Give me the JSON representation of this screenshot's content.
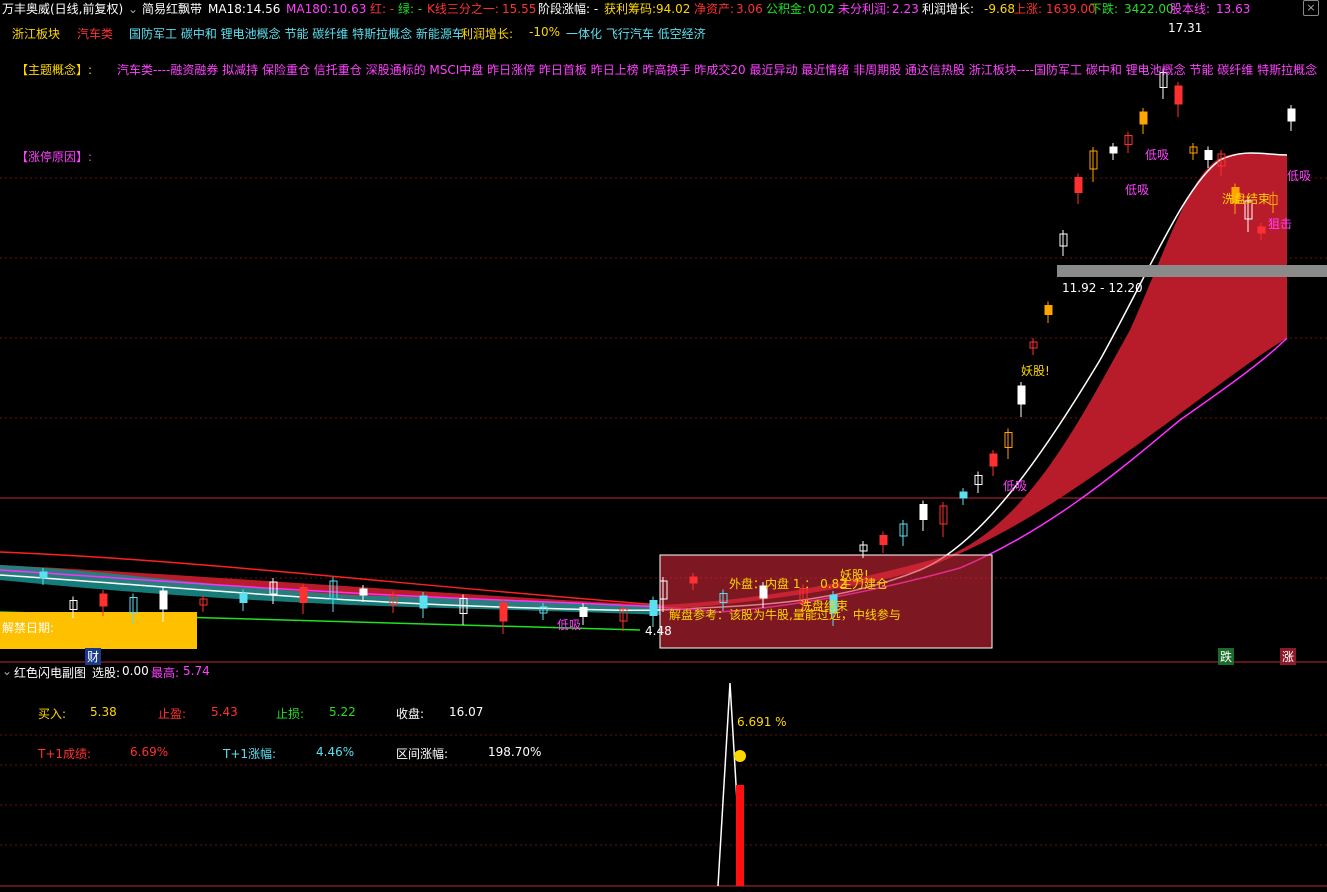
{
  "header": {
    "app_title": "万丰奥威(日线,前复权)",
    "indicator_name": "简易红飘带",
    "ma18_label": "MA18:",
    "ma18_value": "14.56",
    "ma180_label": "MA180:",
    "ma180_value": "10.63",
    "red_label": "红: -",
    "green_label": "绿: -",
    "k_third_label": "K线三分之一:",
    "k_third_value": "15.55",
    "stage_label": "阶段涨幅: -",
    "profit_chip_label": "获利筹码:",
    "profit_chip_value": "94.02",
    "net_asset_label": "净资产:",
    "net_asset_value": "3.06",
    "reserve_label": "公积金:",
    "reserve_value": "0.02",
    "undist_label": "未分利润:",
    "undist_value": "2.23",
    "profit_growth_label": "利润增长:",
    "profit_growth_value": "-9.68",
    "up_label": "上涨:",
    "up_value": "1639.00",
    "down_label": "下跌:",
    "down_value": "3422.00",
    "equity_label": "股本线:",
    "equity_value": "13.63",
    "close_icon": "close-icon"
  },
  "tags_row": {
    "region": "浙江板块",
    "sector": "汽车类",
    "concepts": "国防军工  碳中和  锂电池概念  节能  碳纤维  特斯拉概念  新能源车",
    "concepts2": "一体化  飞行汽车  低空经济",
    "profit_growth_tag": "利润增长:",
    "profit_growth_tag_value": "-10%"
  },
  "theme": {
    "label": "【主题概念】:",
    "text": "汽车类----融资融券  拟减持  保险重仓  信托重仓  深股通标的  MSCI中盘  昨日涨停  昨日首板  昨日上榜  昨高换手  昨成交20  最近异动  最近情绪  非周期股  通达信热股  浙江板块----国防军工  碳中和  锂电池概念  节能  碳纤维  特斯拉概念"
  },
  "limit_reason": {
    "label": "【涨停原因】:"
  },
  "annotations": {
    "high_price": "17.31",
    "low_price": "4.48",
    "price_band": "11.92 - 12.20",
    "yao_gu_1": "妖股!",
    "yao_gu_2": "妖股!",
    "di_xi_1": "低吸",
    "di_xi_2": "低吸",
    "di_xi_3": "低吸",
    "di_xi_4": "低吸",
    "di_xi_5": "低吸",
    "zu_ji": "狙击",
    "shakeout_end": "洗盘结束",
    "wash_end_2": "洗盘结束",
    "outer_inner": "外盘：内盘  1  ：  0.82",
    "main_force": "主力建仓",
    "solution_ref": "解盘参考：该股为牛股,量能过远，中线参与",
    "unlock_date": "解禁日期:",
    "cai_tag": "财",
    "die_tag": "跌",
    "zhang_tag": "涨"
  },
  "sub_chart": {
    "title": "红色闪电副图",
    "select_label": "选股:",
    "select_value": "0.00",
    "max_label": "最高:",
    "max_value": "5.74",
    "buy_label": "买入:",
    "buy_value": "5.38",
    "tp_label": "止盈:",
    "tp_value": "5.43",
    "sl_label": "止损:",
    "sl_value": "5.22",
    "close_label": "收盘:",
    "close_value": "16.07",
    "t1_score_label": "T+1成绩:",
    "t1_score_value": "6.69%",
    "t1_rise_label": "T+1涨幅:",
    "t1_rise_value": "4.46%",
    "range_label": "区间涨幅:",
    "range_value": "198.70%",
    "peak_label": "6.691 %"
  },
  "colors": {
    "red": "#ff3030",
    "green": "#20e020",
    "yellow": "#ffd700",
    "cyan": "#5ae0f0",
    "magenta": "#ff40ff",
    "ribbon": "#b81c2a",
    "orange": "#ffa500"
  }
}
